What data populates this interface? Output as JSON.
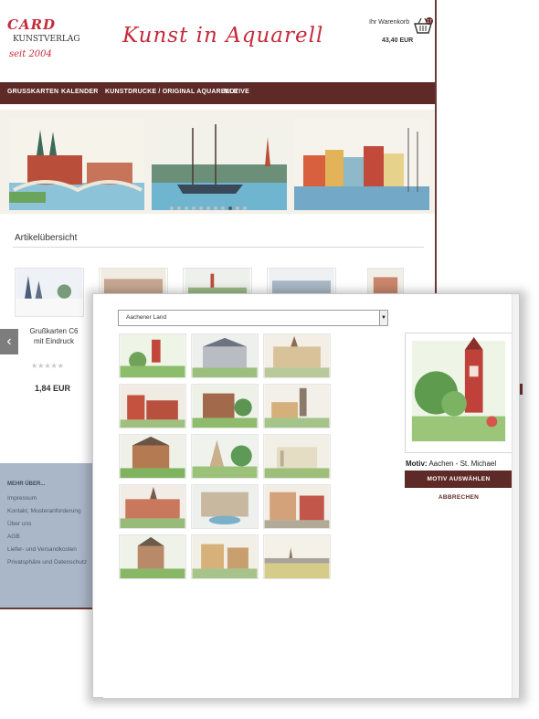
{
  "logo": {
    "card": "CARD",
    "kunstverlag": "KUNSTVERLAG",
    "since": "seit 2004"
  },
  "header": {
    "title": "Kunst in Aquarell"
  },
  "cart": {
    "label": "Ihr Warenkorb",
    "total": "43,40 EUR",
    "count": "17"
  },
  "nav": {
    "items": [
      "GRUSSKARTEN",
      "KALENDER",
      "KUNSTDRUCKE / ORIGINAL AQUARELLE",
      "MOTIVE"
    ]
  },
  "section": {
    "articles_title": "Artikelübersicht"
  },
  "product": {
    "name": "Grußkarten C6 mit Eindruck",
    "stars": "★★★★★",
    "price": "1,84 EUR"
  },
  "footer": {
    "heading": "MEHR ÜBER...",
    "links": [
      "Impressum",
      "Kontakt, Musteranforderung",
      "Über uns",
      "AGB",
      "Liefer- und Versandkosten",
      "Privatsphäre und Datenschutz"
    ]
  },
  "modal": {
    "region_value": "Aachener Land",
    "motif_label": "Motiv:",
    "motif_value": "Aachen - St. Michael",
    "select_button": "MOTIV AUSWÄHLEN",
    "cancel_button": "ABBRECHEN"
  },
  "colors": {
    "brand": "#5e2a27",
    "accent_red": "#c62a3b",
    "footer_bg": "#aab7c8"
  },
  "icons": {
    "cart": "shopping-basket-icon",
    "carousel_prev": "chevron-left-icon",
    "select": "caret-down-icon"
  }
}
